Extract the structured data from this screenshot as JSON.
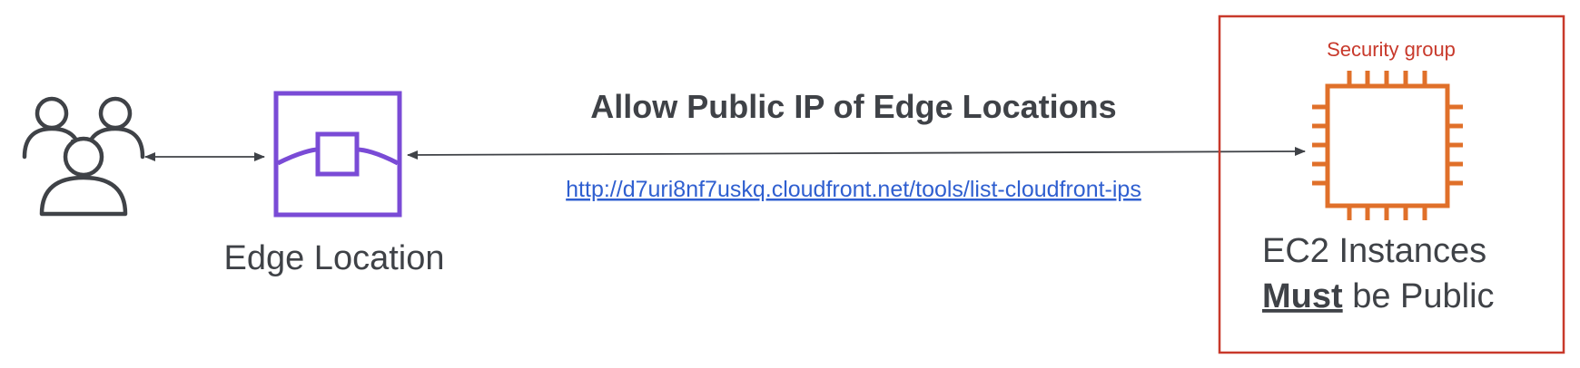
{
  "title": "Allow Public IP of Edge Locations",
  "url": "http://d7uri8nf7uskq.cloudfront.net/tools/list-cloudfront-ips",
  "edge_location_label": "Edge Location",
  "security_group_label": "Security group",
  "ec2_label_line1": "EC2 Instances",
  "ec2_label_must": "Must",
  "ec2_label_rest": " be Public",
  "icons": {
    "users": "users-icon",
    "edge": "edge-location-icon",
    "ec2": "ec2-chip-icon"
  },
  "colors": {
    "text": "#3f4247",
    "edge_purple": "#7a4bd6",
    "ec2_orange": "#e0702a",
    "security_group_red": "#c8392b",
    "link_blue": "#2f5fd0"
  }
}
